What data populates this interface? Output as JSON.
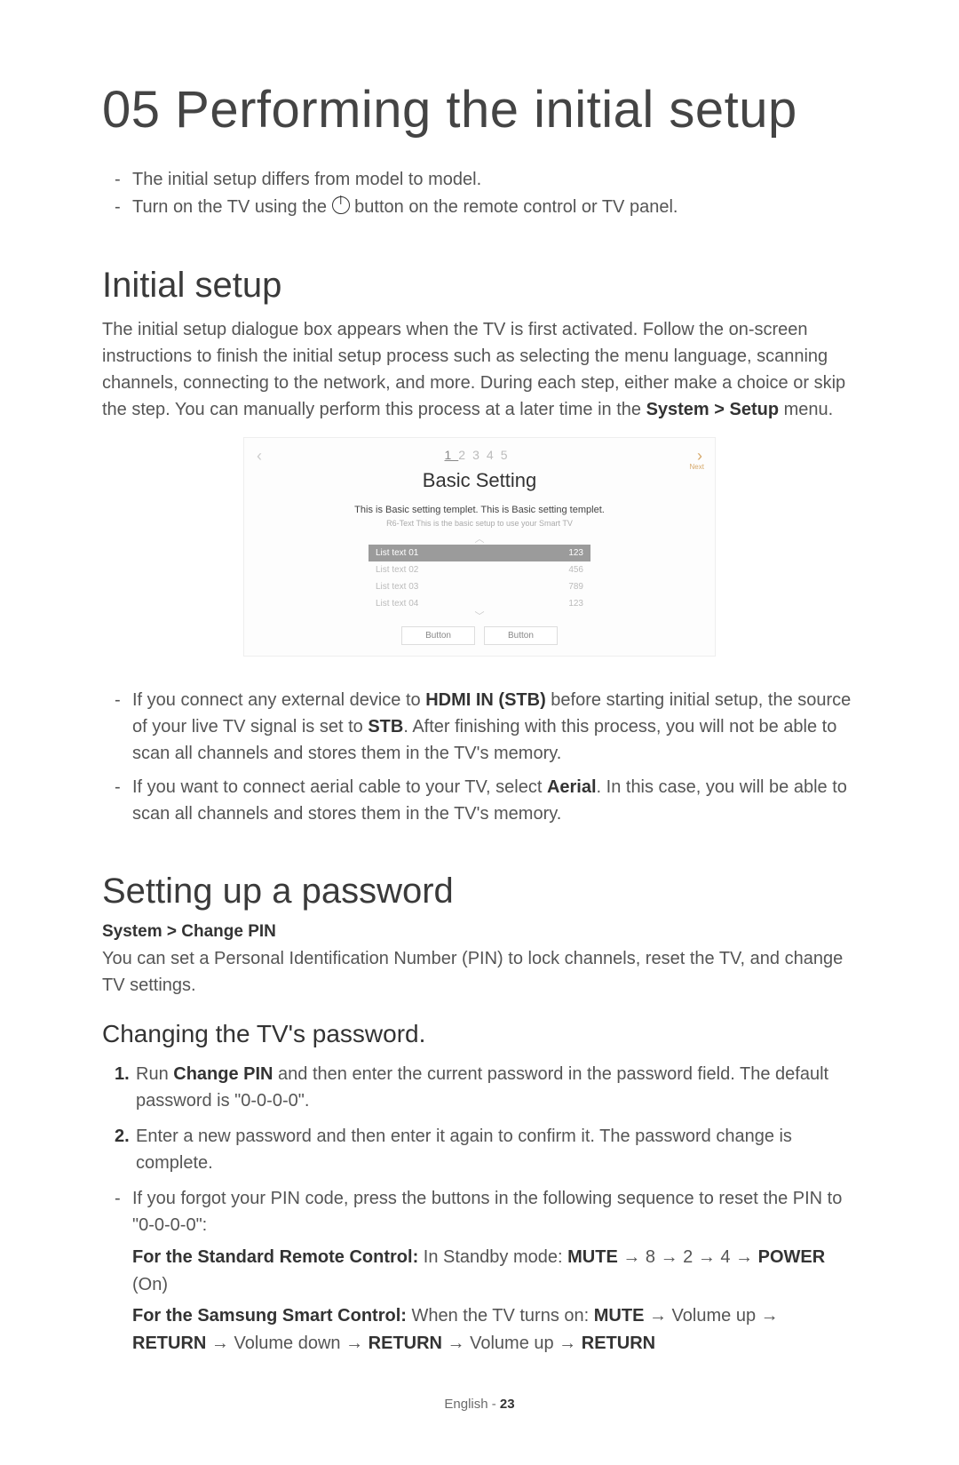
{
  "chapter": "05 Performing the initial setup",
  "intro": {
    "item1": "The initial setup differs from model to model.",
    "item2_a": "Turn on the TV using the ",
    "item2_b": " button on the remote control or TV panel."
  },
  "section1": {
    "heading": "Initial setup",
    "para_a": "The initial setup dialogue box appears when the TV is first activated. Follow the on-screen instructions to finish the initial setup process such as selecting the menu language, scanning channels, connecting to the network, and more. During each step, either make a choice or skip the step. You can manually perform this process at a later time in the ",
    "para_b": "System > Setup",
    "para_c": " menu."
  },
  "figure": {
    "steps": {
      "s1": "1",
      "s2": "2",
      "s3": "3",
      "s4": "4",
      "s5": "5"
    },
    "title": "Basic Setting",
    "line1": "This is Basic setting templet. This is Basic setting templet.",
    "line2": "R6-Text This is the basic setup to use your Smart TV",
    "rows": [
      {
        "label": "List text 01",
        "value": "123"
      },
      {
        "label": "List text 02",
        "value": "456"
      },
      {
        "label": "List text 03",
        "value": "789"
      },
      {
        "label": "List text 04",
        "value": "123"
      }
    ],
    "btn1": "Button",
    "btn2": "Button",
    "next": "Next"
  },
  "notes1": {
    "n1_a": "If you connect any external device to ",
    "n1_b": "HDMI IN (STB)",
    "n1_c": " before starting initial setup, the source of your live TV signal is set to ",
    "n1_d": "STB",
    "n1_e": ". After finishing with this process, you will not be able to scan all channels and stores them in the TV's memory.",
    "n2_a": "If you want to connect aerial cable to your TV, select ",
    "n2_b": "Aerial",
    "n2_c": ". In this case, you will be able to scan all channels and stores them in the TV's memory."
  },
  "section2": {
    "heading": "Setting up a password",
    "path": "System > Change PIN",
    "para": "You can set a Personal Identification Number (PIN) to lock channels, reset the TV, and change TV settings.",
    "sub": "Changing the TV's password.",
    "step1_a": "Run ",
    "step1_b": "Change PIN",
    "step1_c": " and then enter the current password in the password field. The default password is \"0-0-0-0\".",
    "step2": "Enter a new password and then enter it again to confirm it. The password change is complete.",
    "dash": "If you forgot your PIN code, press the buttons in the following sequence to reset the PIN to \"0-0-0-0\":",
    "r1_a": "For the Standard Remote Control:",
    "r1_b": " In Standby mode: ",
    "r1_c": "MUTE",
    "r1_d": " → 8 → 2 → 4 → ",
    "r1_e": "POWER",
    "r1_f": " (On)",
    "r2_a": "For the Samsung Smart Control:",
    "r2_b": " When the TV turns on: ",
    "r2_c": "MUTE",
    "r2_d": " → Volume up → ",
    "r2_e": "RETURN",
    "r2_f": " → Volume down → ",
    "r2_g": "RETURN",
    "r2_h": " → Volume up → ",
    "r2_i": "RETURN"
  },
  "footer": {
    "lang": "English - ",
    "page": "23"
  }
}
